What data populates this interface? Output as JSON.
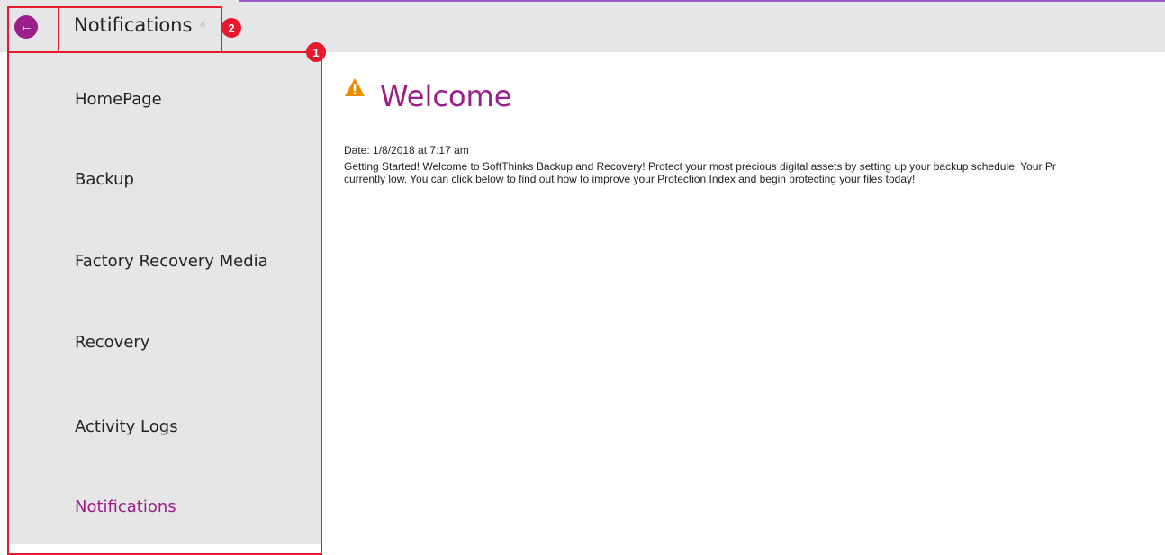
{
  "header": {
    "title": "Notifications",
    "caret": "^",
    "back_icon": "arrow-left-icon"
  },
  "annotations": {
    "badge_1": "1",
    "badge_2": "2"
  },
  "sidebar": {
    "items": [
      {
        "label": "HomePage"
      },
      {
        "label": "Backup"
      },
      {
        "label": "Factory Recovery Media"
      },
      {
        "label": "Recovery"
      },
      {
        "label": "Activity Logs"
      },
      {
        "label": "Notifications"
      }
    ],
    "active_item": "Notifications"
  },
  "main": {
    "heading": "Welcome",
    "heading_icon": "warning-icon",
    "date": "Date: 1/8/2018 at 7:17 am",
    "message_line1": "Getting Started! Welcome to SoftThinks Backup and Recovery! Protect your most precious digital assets by setting up your backup schedule. Your Pr",
    "message_line2": "currently low. You can click below to find out how to improve your Protection Index and begin protecting your files today!"
  },
  "colors": {
    "accent": "#9a1f8a",
    "warning": "#f08a00",
    "annotation": "#e8192c",
    "bar_bg": "#e6e6e6"
  }
}
